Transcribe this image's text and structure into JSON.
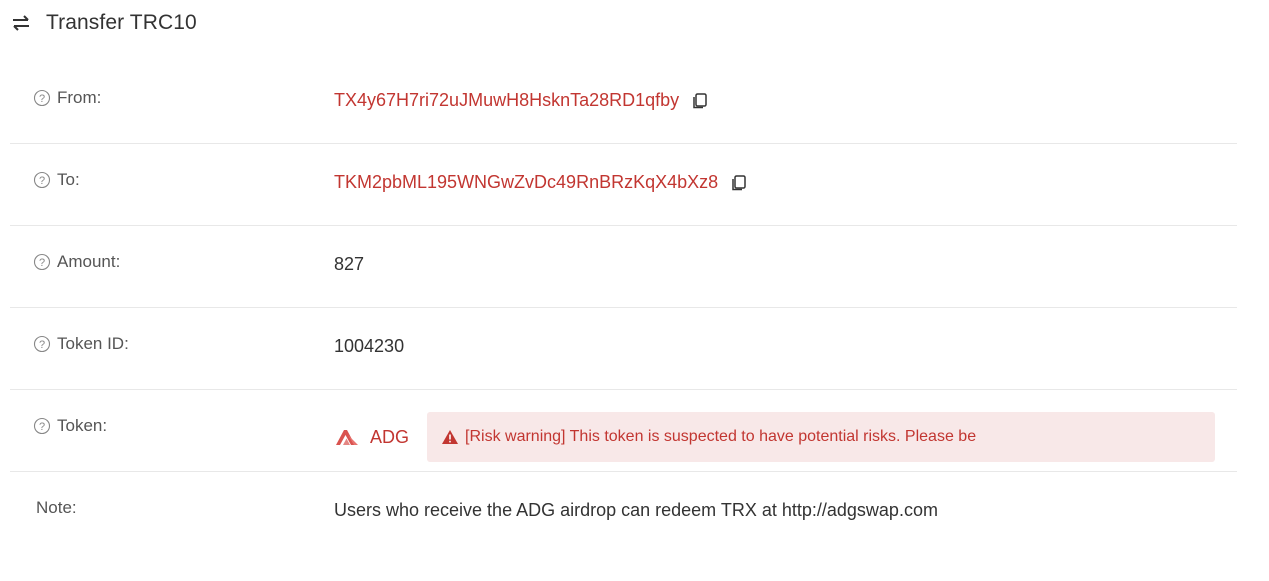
{
  "header": {
    "icon": "transfer-arrows-icon",
    "title": "Transfer TRC10"
  },
  "fields": {
    "from": {
      "label": "From:",
      "value": "TX4y67H7ri72uJMuwH8HsknTa28RD1qfby"
    },
    "to": {
      "label": "To:",
      "value": "TKM2pbML195WNGwZvDc49RnBRzKqX4bXz8"
    },
    "amount": {
      "label": "Amount:",
      "value": "827"
    },
    "token_id": {
      "label": "Token ID:",
      "value": "1004230"
    },
    "token": {
      "label": "Token:",
      "name": "ADG",
      "risk_warning": "[Risk warning] This token is suspected to have potential risks. Please be"
    },
    "note": {
      "label": "Note:",
      "value": "Users who receive the ADG airdrop can redeem TRX at http://adgswap.com"
    }
  },
  "colors": {
    "accent_red": "#c23631",
    "warning_bg": "#f8e8e8",
    "label_gray": "#555555",
    "divider": "#e8e8e8"
  }
}
